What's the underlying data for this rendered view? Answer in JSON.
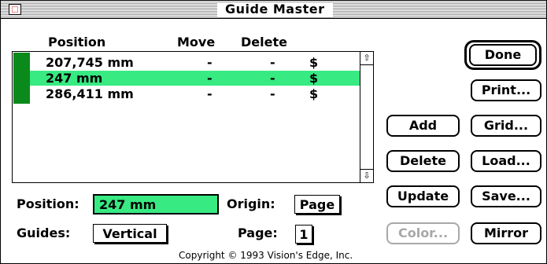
{
  "window": {
    "title": "Guide Master"
  },
  "columns": {
    "position": "Position",
    "move": "Move",
    "delete": "Delete"
  },
  "guides": [
    {
      "position": "207,745 mm",
      "move": "-",
      "delete": "-",
      "flag": "$",
      "selected": false
    },
    {
      "position": "247 mm",
      "move": "-",
      "delete": "-",
      "flag": "$",
      "selected": true
    },
    {
      "position": "286,411 mm",
      "move": "-",
      "delete": "-",
      "flag": "$",
      "selected": false
    }
  ],
  "fields": {
    "position_label": "Position:",
    "position_value": "247 mm",
    "origin_label": "Origin:",
    "origin_value": "Page",
    "guides_label": "Guides:",
    "guides_value": "Vertical",
    "page_label": "Page:",
    "page_value": "1"
  },
  "buttons": {
    "done": "Done",
    "print": "Print...",
    "add": "Add",
    "grid": "Grid...",
    "delete": "Delete",
    "load": "Load...",
    "update": "Update",
    "save": "Save...",
    "color": "Color...",
    "mirror": "Mirror"
  },
  "footer": {
    "copyright": "Copyright © 1993 Vision's Edge, Inc."
  },
  "colors": {
    "selection": "#37ea82",
    "marker": "#0a8a1a"
  },
  "icons": {
    "scroll_up": "up-arrow-icon",
    "scroll_down": "down-arrow-icon",
    "close": "close-box-icon"
  }
}
